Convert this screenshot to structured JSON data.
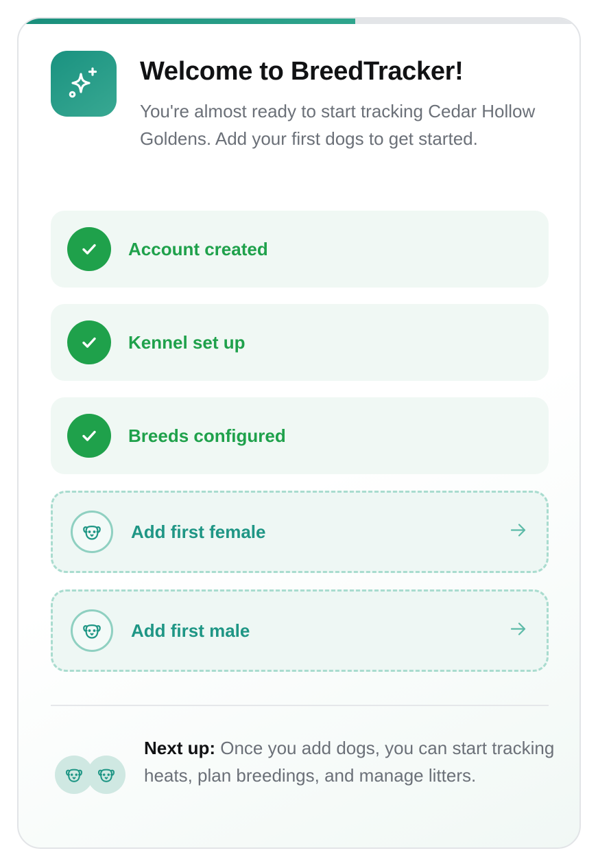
{
  "progress": {
    "fraction": 0.6
  },
  "header": {
    "title": "Welcome to BreedTracker!",
    "subtitle": "You're almost ready to start tracking Cedar Hollow Goldens. Add your first dogs to get started.",
    "icon": "sparkles-icon"
  },
  "completed_steps": [
    {
      "label": "Account created",
      "icon": "check-icon"
    },
    {
      "label": "Kennel set up",
      "icon": "check-icon"
    },
    {
      "label": "Breeds configured",
      "icon": "check-icon"
    }
  ],
  "actions": [
    {
      "label": "Add first female",
      "icon": "dog-icon",
      "arrow": "arrow-right-icon"
    },
    {
      "label": "Add first male",
      "icon": "dog-icon",
      "arrow": "arrow-right-icon"
    }
  ],
  "next_up": {
    "lead": "Next up:",
    "text": " Once you add dogs, you can start tracking heats, plan breedings, and manage litters."
  },
  "colors": {
    "accent": "#1a9280",
    "success": "#1fa14b",
    "muted_text": "#6b7078"
  }
}
